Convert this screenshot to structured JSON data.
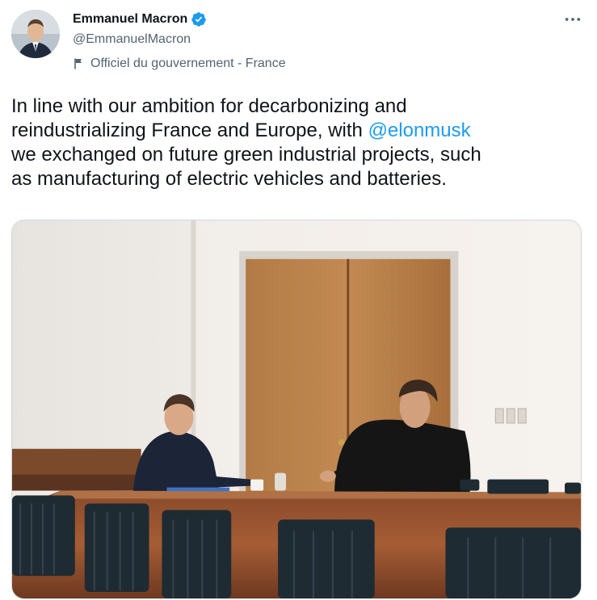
{
  "author": {
    "display_name": "Emmanuel Macron",
    "handle": "@EmmanuelMacron",
    "label": "Officiel du gouvernement - France",
    "avatar_icon": "avatar-photo",
    "verified_icon": "verified-badge-icon",
    "label_icon": "flag-icon"
  },
  "actions": {
    "more_icon": "more-options-icon"
  },
  "tweet": {
    "text_before": "In line with our ambition for decarbonizing and\nreindustrializing France and Europe, with ",
    "mention": "@elonmusk",
    "text_after": "\nwe exchanged on future green industrial projects, such\nas manufacturing of electric vehicles and batteries."
  },
  "media": {
    "type": "photo"
  },
  "colors": {
    "text": "#0f1419",
    "secondary_text": "#536471",
    "link": "#1d9bf0",
    "verified": "#1d9bf0"
  }
}
